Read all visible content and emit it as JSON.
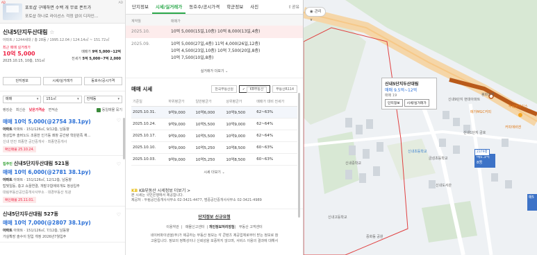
{
  "ad": {
    "badge": "AD",
    "title": "포토샵 구매하면 수백 개 무료 폰트가",
    "desc": "포토샵 하나로 라이선스 걱정 없이 디자인…",
    "ad_mark": "AD"
  },
  "summary": {
    "name": "신내5단지두산대림",
    "star": "☆",
    "info": "아파트 / 1244세대 / 총 28동 / 1995.12.04 / 124.14㎡ ~ 151.72㎡",
    "recent_label": "최근 매매 실거래가",
    "recent_value": "10억 5,000",
    "recent_date": "2025.10.15, 10층, 151㎡",
    "side_sale_label": "매매가",
    "side_sale": "9억 5,000~12억",
    "side_lease_label": "전세가",
    "side_lease": "5억 5,000~7억 2,000",
    "tabs": [
      "단지정보",
      "시세/실거래가",
      "동호수/공시가격"
    ]
  },
  "filters": {
    "type": "매매",
    "area": "151㎡",
    "floor": "전체동"
  },
  "sort": {
    "opts": [
      "랭킹순",
      "최신순",
      "낮은가격순",
      "면적순"
    ],
    "active": "낮은가격순",
    "check": "동일매물 묶기"
  },
  "listings": [
    {
      "tag": "",
      "name": "",
      "price": "매매 10억 5,000(@2754 38.1py)",
      "l1": "아파트 · 151/126㎡, 9/12층, 남동향",
      "l2": "정상입주 솔버노드 조용한 인기동 쾌창 공간량 학원원족 재…",
      "l3": "신내 빈진 최종연 공인중개사 · 최종연중개사",
      "conf": "확인매물 25.10.24."
    },
    {
      "tag": "집주인",
      "name": "신내5단지두산대림 521동",
      "price": "매매 10억 6,000(@2781 38.1py)",
      "l1": "아파트 · 151/126㎡, 12/12층, 남동향",
      "l2": "탑빛일등, 층고 쇼끌연결, 개발구합에외개도 정상입주",
      "l3": "대림부동산공인중개사사무소 · 대경부동산 직광",
      "conf": "확인매물 25.11.01."
    },
    {
      "tag": "",
      "name": "신내5단지두산대림 527동",
      "price": "매매 10억 7,000(@2807 38.1py)",
      "l1": "아파트 · 151/126㎡, 7/12층, 남동향",
      "l2": "가실확장 솔수이 임입 개정 2026년7월입주",
      "l3": "",
      "conf": ""
    }
  ],
  "mid_tabs": [
    "단지정보",
    "시세/실거래가",
    "동호수/공시가격",
    "학군정보",
    "사진"
  ],
  "mid_active_tab": "시세/실거래가",
  "mid_share": "공유",
  "history": {
    "headers": [
      "계약월",
      "매매가"
    ],
    "rows": [
      {
        "date": "2025.10.",
        "lines": [
          "10억 5,000(15일,10층)    10억 8,000(13일,4층)"
        ],
        "hl": true
      },
      {
        "date": "2025.09.",
        "lines": [
          "10억 5,000(27일,4층)    11억 4,000(26일,12층)",
          "10억 4,500(23일,10층)    10억 7,500(20일,8층)",
          "10억 7,500(10일,8층)"
        ],
        "hl": false
      }
    ],
    "more": "실거래가 더보기 ⌄"
  },
  "sale_price": {
    "title": "매매 시세",
    "sources": [
      "한국부동산원",
      "KB부동산",
      "부동산R114"
    ],
    "active_source": "KB부동산",
    "headers": [
      "기준일",
      "하위평균가",
      "일반평균가",
      "상위평균가",
      "매매가 대비 전세가"
    ],
    "rows": [
      [
        "2025.10.31.",
        "9억9,000",
        "10억6,000",
        "10억9,500",
        "62~63%"
      ],
      [
        "2025.10.24.",
        "9억9,000",
        "10억5,500",
        "10억9,000",
        "62~64%"
      ],
      [
        "2025.10.17.",
        "9억9,000",
        "10억5,500",
        "10억9,000",
        "62~64%"
      ],
      [
        "2025.10.10.",
        "9억9,000",
        "10억5,250",
        "10억8,500",
        "60~63%"
      ],
      [
        "2025.10.03.",
        "9억9,000",
        "10억5,250",
        "10억8,500",
        "60~63%"
      ]
    ],
    "more": "시세 더보기 ⌄"
  },
  "kb": {
    "title": "KB부동산 시세정보 더보기 >",
    "l1": "본 시세는 국민은행에서 제공합니다.",
    "l2": "제공처 : 두림공인중개사사무소 02-3421-4477, 범중공인중개사사무소 02-3421-4989"
  },
  "footer": {
    "title": "단지정보 신규요청",
    "links": [
      "이용약관",
      "매물신고센터",
      "개인정보처리방침",
      "부동산 고객센터"
    ],
    "note1": "네이버파이낸셜(주)가 제공하는 부동산 정보는 각 콘텐츠 제공업체로부터 받는 정보로 참",
    "note2": "고용입니다. 정보의 정확성이나 신뢰성을 보증하지 않으며, 서비스 이용의 결과에 대해서"
  },
  "map": {
    "search": "관리 ∨",
    "callout_name": "신내5단지두산대림",
    "callout_price": "매매 9.5억~12억",
    "callout_sub": "매매 19",
    "callout_btn1": "단지정보",
    "callout_btn2": "시세/실거래가",
    "marker_top": "2379평",
    "marker_price": "매5.3억",
    "marker_sub": "8동",
    "marker2": "매5",
    "labels": [
      "신내역",
      "신내중학교",
      "신내고등학교",
      "봉화산역",
      "금성초등학교",
      "신내9단지 현대아파트",
      "중화동 공원",
      "신내1단지 금호",
      "신내도서관"
    ],
    "pois": [
      "메가MGC커피",
      "커피에비엔",
      "투썸플레이스",
      "신내초등학교"
    ]
  }
}
